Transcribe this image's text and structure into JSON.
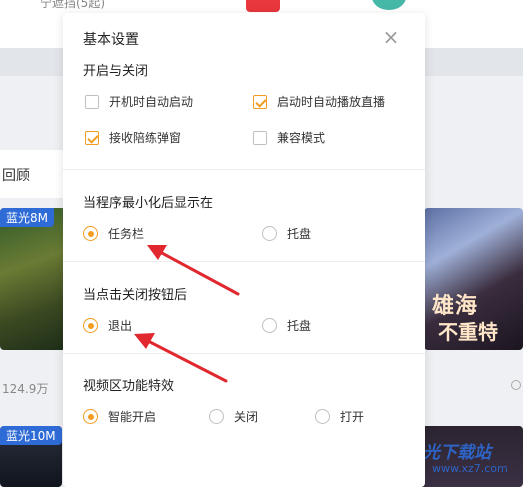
{
  "background": {
    "top_text": "宁遮挡(5起)",
    "left_card_label": "回顾",
    "thumb_badges": [
      "蓝光8M",
      "蓝光10M"
    ],
    "views": "124.9万",
    "promo_line1": "雄海",
    "promo_line2": "不重特",
    "watermark_title": "极光下载站",
    "watermark_url": "www.xz7.com"
  },
  "dialog": {
    "title": "基本设置",
    "close_icon": "×",
    "sections": {
      "startup": {
        "title": "开启与关闭",
        "options": [
          {
            "label": "开机时自动启动",
            "checked": false
          },
          {
            "label": "启动时自动播放直播",
            "checked": true
          },
          {
            "label": "接收陪练弹窗",
            "checked": true
          },
          {
            "label": "兼容模式",
            "checked": false
          }
        ]
      },
      "minimize": {
        "title": "当程序最小化后显示在",
        "options": [
          {
            "label": "任务栏",
            "selected": true
          },
          {
            "label": "托盘",
            "selected": false
          }
        ]
      },
      "close_button": {
        "title": "当点击关闭按钮后",
        "options": [
          {
            "label": "退出",
            "selected": true
          },
          {
            "label": "托盘",
            "selected": false
          }
        ]
      },
      "video_effects": {
        "title": "视频区功能特效",
        "options": [
          {
            "label": "智能开启",
            "selected": true
          },
          {
            "label": "关闭",
            "selected": false
          },
          {
            "label": "打开",
            "selected": false
          }
        ]
      }
    }
  },
  "colors": {
    "accent": "#f29c22",
    "arrow": "#e0282e",
    "badge": "#2f6bd6"
  },
  "annotations": {
    "arrow_icons": [
      "arrow-to-taskbar-option",
      "arrow-to-exit-option"
    ]
  }
}
